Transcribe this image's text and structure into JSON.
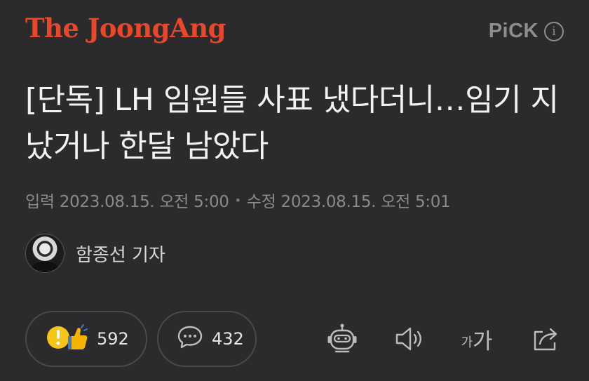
{
  "header": {
    "brand": "The JoongAng",
    "pick_label": "PiCK",
    "info_icon": "info-icon"
  },
  "article": {
    "headline": "[단독] LH 임원들 사표 냈다더니…임기 지났거나 한달 남았다",
    "meta": {
      "published": "입력 2023.08.15. 오전 5:00",
      "separator": "•",
      "modified": "수정 2023.08.15. 오전 5:01"
    },
    "author": "함종선 기자"
  },
  "actions": {
    "reactions_count": "592",
    "comments_count": "432",
    "icons": [
      "reaction-emoji-icon",
      "comment-bubble-icon",
      "summary-robot-icon",
      "speaker-icon",
      "font-size-icon",
      "share-icon"
    ],
    "font_size_glyph_small": "가",
    "font_size_glyph_large": "가"
  },
  "colors": {
    "background": "#2b2b2d",
    "brand": "#e8472a",
    "headline": "#f2f2f2",
    "muted": "#8a8a8d"
  }
}
